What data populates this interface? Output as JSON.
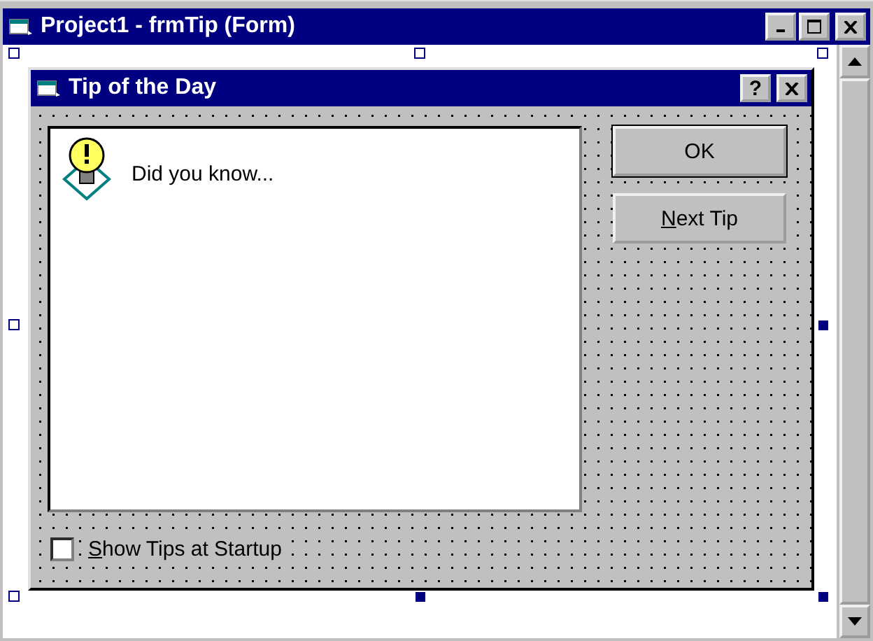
{
  "window": {
    "title": "Project1 - frmTip (Form)"
  },
  "form": {
    "title": "Tip of the Day",
    "help_button": "?",
    "tip_text": "Did you know...",
    "buttons": [
      {
        "label": "OK",
        "default": true,
        "access_key": false
      },
      {
        "label": "Next Tip",
        "default": false,
        "access_key": true
      }
    ],
    "startup_checkbox": {
      "label": "Show Tips at Startup",
      "checked": false,
      "access_key": true
    }
  }
}
